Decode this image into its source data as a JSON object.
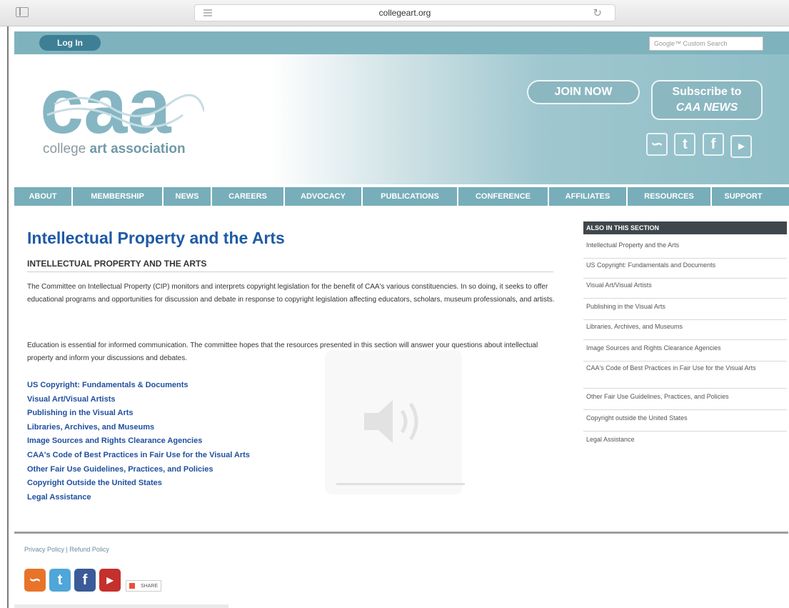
{
  "browser": {
    "url": "collegeart.org"
  },
  "header": {
    "login_label": "Log In",
    "search_placeholder": "Google™ Custom Search",
    "logo_text": "caa",
    "tagline_pre": "college",
    "tagline_bold": "art association",
    "join_label": "JOIN NOW",
    "subscribe_line1": "Subscribe to",
    "subscribe_line2": "CAA NEWS",
    "social_icons": [
      "rss-icon",
      "twitter-icon",
      "facebook-icon",
      "youtube-icon"
    ]
  },
  "nav": {
    "items": [
      "ABOUT",
      "MEMBERSHIP",
      "NEWS",
      "CAREERS",
      "ADVOCACY",
      "PUBLICATIONS",
      "CONFERENCE",
      "AFFILIATES",
      "RESOURCES",
      "SUPPORT"
    ]
  },
  "main": {
    "title": "Intellectual Property and the Arts",
    "section_heading": "INTELLECTUAL PROPERTY AND THE ARTS",
    "para1": "The Committee on Intellectual Property (CIP) monitors and interprets copyright legislation for the benefit of CAA's various constituencies. In so doing, it seeks to offer educational programs and opportunities for discussion and debate in response to copyright legislation affecting educators, scholars, museum professionals, and artists.",
    "para2": "Education is essential for informed communication. The committee hopes that the resources presented in this section will answer your questions about intellectual property and inform your discussions and debates.",
    "links": [
      "US Copyright: Fundamentals & Documents",
      "Visual Art/Visual Artists",
      "Publishing in the Visual Arts",
      "Libraries, Archives, and Museums",
      "Image Sources and Rights Clearance Agencies",
      "CAA's Code of Best Practices in Fair Use for the Visual Arts",
      "Other Fair Use Guidelines, Practices, and Policies",
      "Copyright Outside the United States",
      "Legal Assistance"
    ]
  },
  "sidebar": {
    "title": "ALSO IN THIS SECTION",
    "items": [
      "Intellectual Property and the Arts",
      "US Copyright: Fundamentals and Documents",
      "Visual Art/Visual Artists",
      "Publishing in the Visual Arts",
      "Libraries, Archives, and Museums",
      "Image Sources and Rights Clearance Agencies",
      "CAA's Code of Best Practices in Fair Use for the Visual Arts",
      "Other Fair Use Guidelines, Practices, and Policies",
      "Copyright outside the United States",
      "Legal Assistance"
    ]
  },
  "footer": {
    "privacy_label": "Privacy Policy",
    "separator": " | ",
    "refund_label": "Refund Policy",
    "share_label": "SHARE",
    "colors": {
      "rss": "#e8742a",
      "twitter": "#4fa6d8",
      "facebook": "#3b5a98",
      "youtube": "#c4302b"
    }
  },
  "colors": {
    "title_blue": "#1f5aa6",
    "link_blue": "#1f4f9e",
    "header_teal": "#7eb3bd",
    "sidebar_head": "#3f474c"
  }
}
